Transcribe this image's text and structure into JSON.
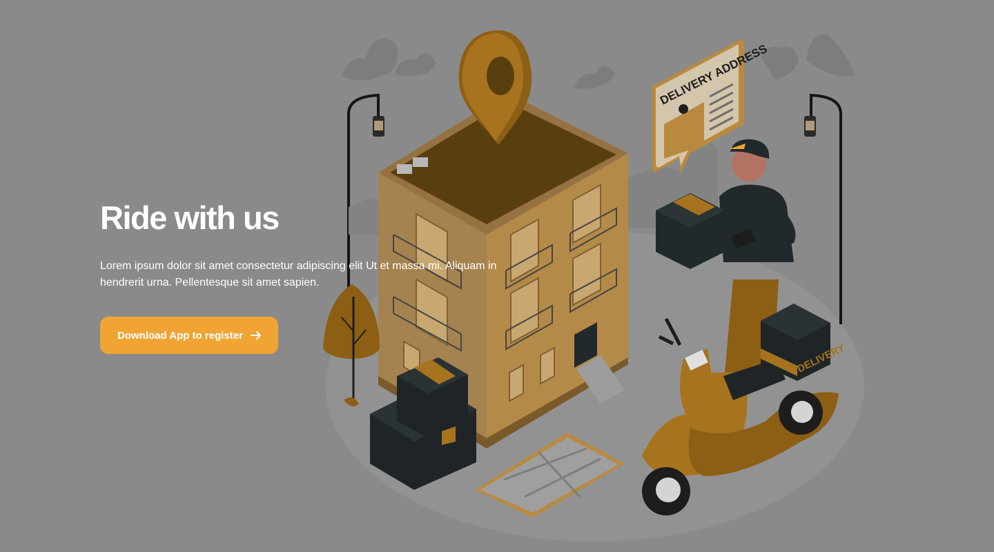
{
  "hero": {
    "title": "Ride with us",
    "description": "Lorem ipsum dolor sit amet consectetur adipiscing elit Ut et massa mi. Aliquam in hendrerit urna. Pellentesque sit amet sapien.",
    "cta_label": "Download App to register",
    "cta_icon": "arrow-right-icon"
  },
  "illustration": {
    "speech_bubble_text": "DELIVERY ADDRESS",
    "scooter_box_text": "DELIVERY"
  },
  "colors": {
    "overlay": "#8a8a8a",
    "accent": "#efa433",
    "building": "#a58350",
    "gold": "#8c5f14",
    "dark_box": "#22292c"
  }
}
